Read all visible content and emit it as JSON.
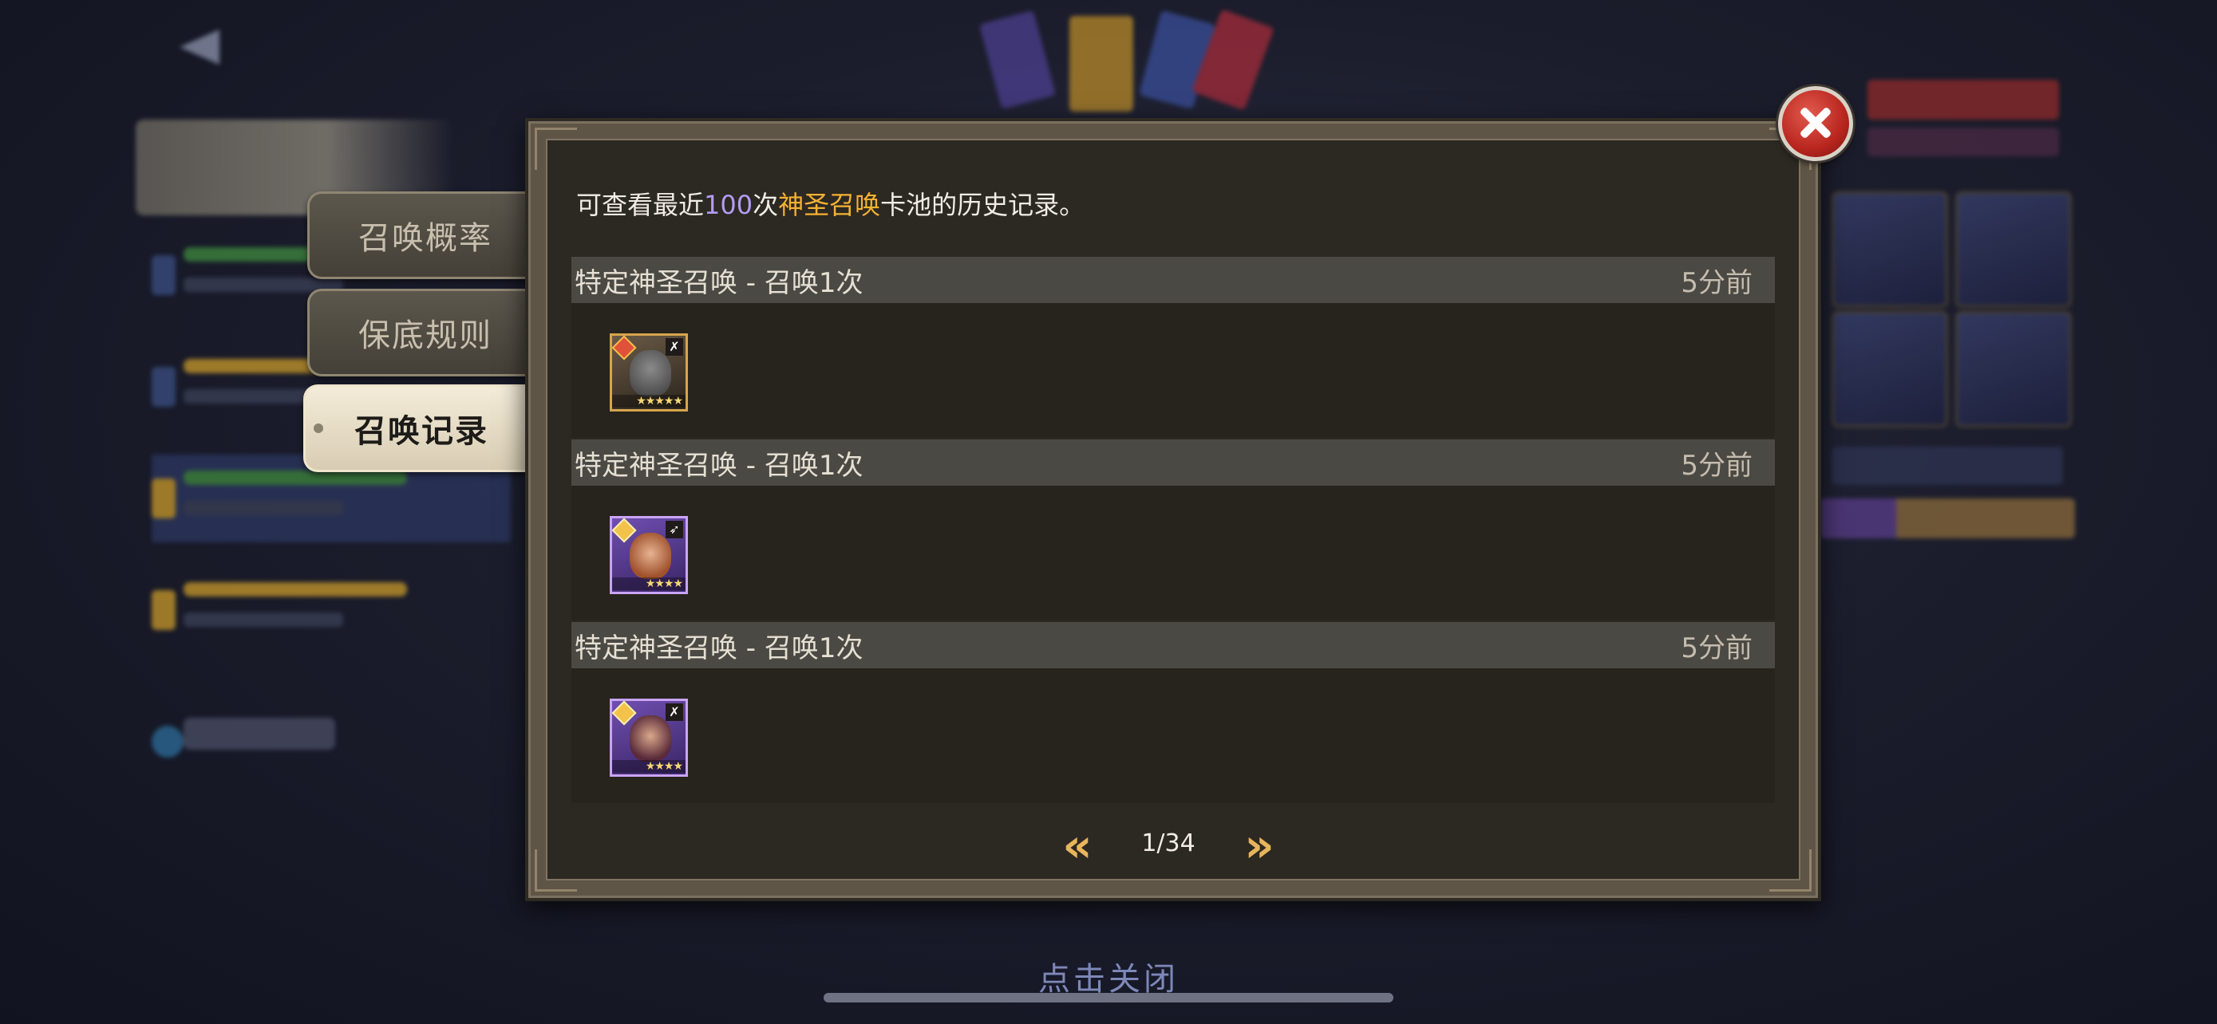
{
  "background": {
    "close_hint": "点击关闭"
  },
  "tabs": [
    {
      "label": "召唤概率",
      "active": false
    },
    {
      "label": "保底规则",
      "active": false
    },
    {
      "label": "召唤记录",
      "active": true
    }
  ],
  "dialog": {
    "intro_prefix": "可查看最近",
    "intro_count": "100",
    "intro_mid": "次",
    "intro_pool": "神圣召唤",
    "intro_suffix": "卡池的历史记录。",
    "records": [
      {
        "title": "特定神圣召唤 - 召唤1次",
        "time": "5分前",
        "hero": {
          "icon": "hero-portrait-dragon-icon",
          "stars": 5,
          "stars_text": "★★★★★",
          "class_glyph": "✗",
          "frame": "gold"
        }
      },
      {
        "title": "特定神圣召唤 - 召唤1次",
        "time": "5分前",
        "hero": {
          "icon": "hero-portrait-archer-icon",
          "stars": 4,
          "stars_text": "★★★★",
          "class_glyph": "➶",
          "frame": "purple"
        }
      },
      {
        "title": "特定神圣召唤 - 召唤1次",
        "time": "5分前",
        "hero": {
          "icon": "hero-portrait-rogue-icon",
          "stars": 4,
          "stars_text": "★★★★",
          "class_glyph": "✗",
          "frame": "purple"
        }
      }
    ],
    "pager": {
      "prev_glyph": "«",
      "next_glyph": "»",
      "page_label": "1/34"
    }
  },
  "colors": {
    "highlight_count": "#b39cf2",
    "highlight_pool": "#f4b233",
    "pager_arrow": "#e7b55c",
    "close_button": "#b8261e"
  }
}
